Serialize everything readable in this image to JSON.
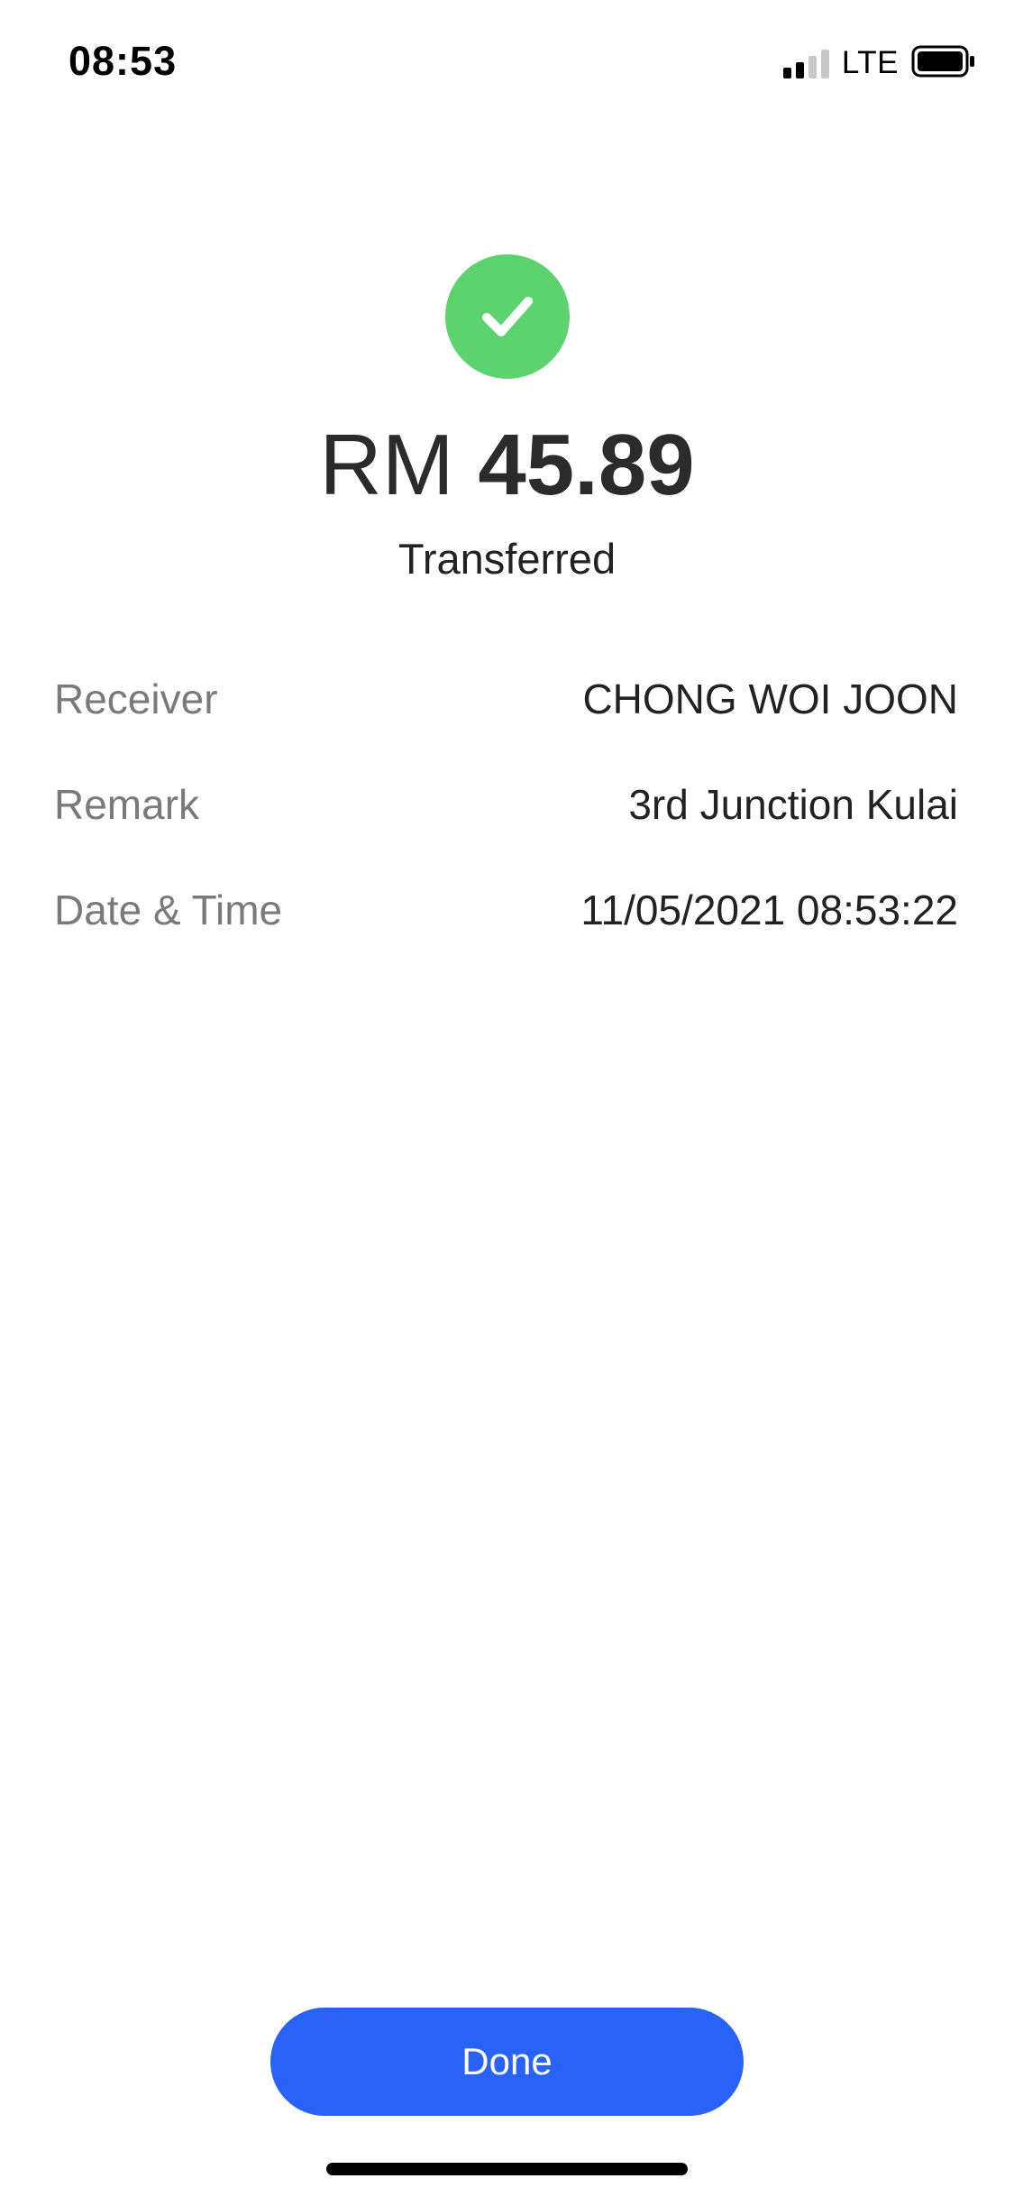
{
  "status_bar": {
    "time": "08:53",
    "network": "LTE",
    "signal_bars_active": 2,
    "signal_bars_total": 4,
    "battery_level": 1.0
  },
  "icons": {
    "success": "check-circle-icon"
  },
  "colors": {
    "success_green": "#5cd36e",
    "primary_blue": "#2962f6",
    "label_gray": "#7a7a7a"
  },
  "transfer": {
    "currency": "RM",
    "amount": "45.89",
    "status": "Transferred"
  },
  "details": [
    {
      "label": "Receiver",
      "value": "CHONG WOI JOON"
    },
    {
      "label": "Remark",
      "value": "3rd Junction Kulai"
    },
    {
      "label": "Date & Time",
      "value": "11/05/2021 08:53:22"
    }
  ],
  "actions": {
    "done_label": "Done"
  }
}
